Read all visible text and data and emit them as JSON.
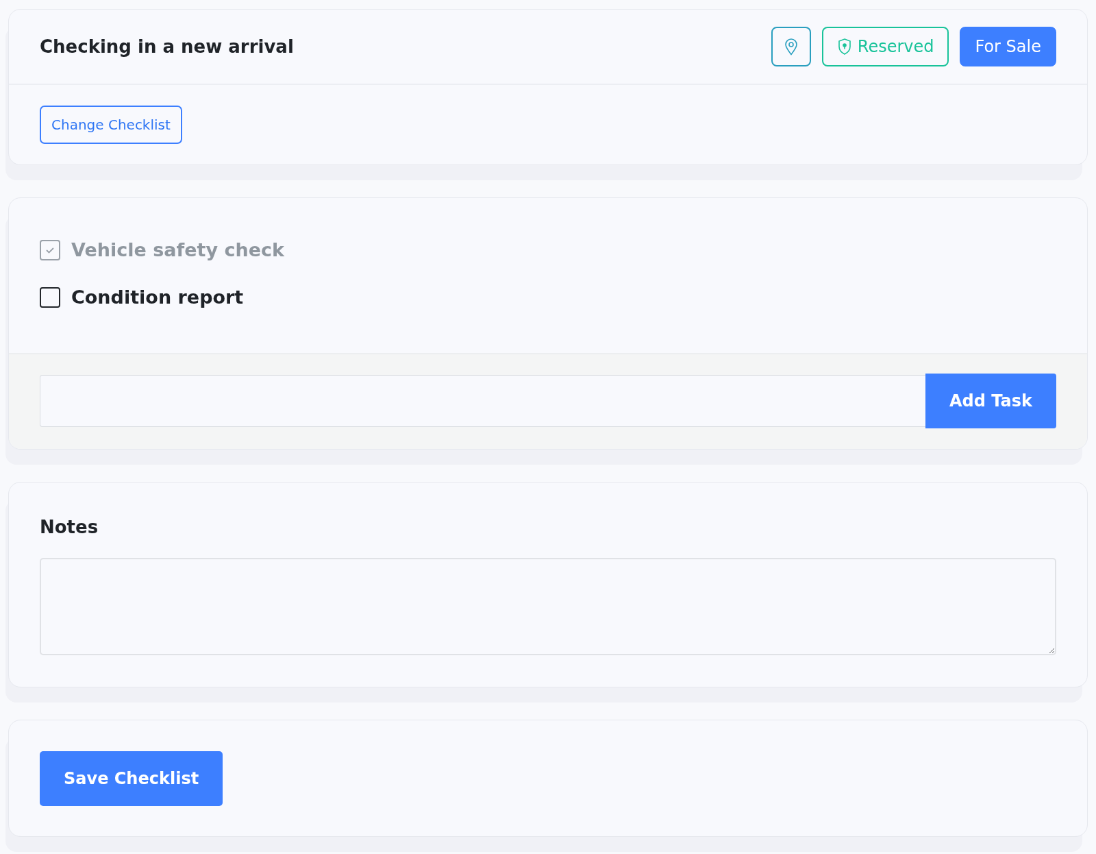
{
  "header": {
    "title": "Checking in a new arrival",
    "badges": [
      {
        "kind": "location"
      },
      {
        "kind": "reserved",
        "label": "Reserved"
      },
      {
        "kind": "sale",
        "label": "For Sale"
      }
    ]
  },
  "change_button": "Change Checklist",
  "tasks": [
    {
      "label": "Vehicle safety check",
      "checked": true
    },
    {
      "label": "Condition report",
      "checked": false
    }
  ],
  "add_task": {
    "button": "Add Task"
  },
  "notes": {
    "title": "Notes"
  },
  "save_button": "Save Checklist"
}
